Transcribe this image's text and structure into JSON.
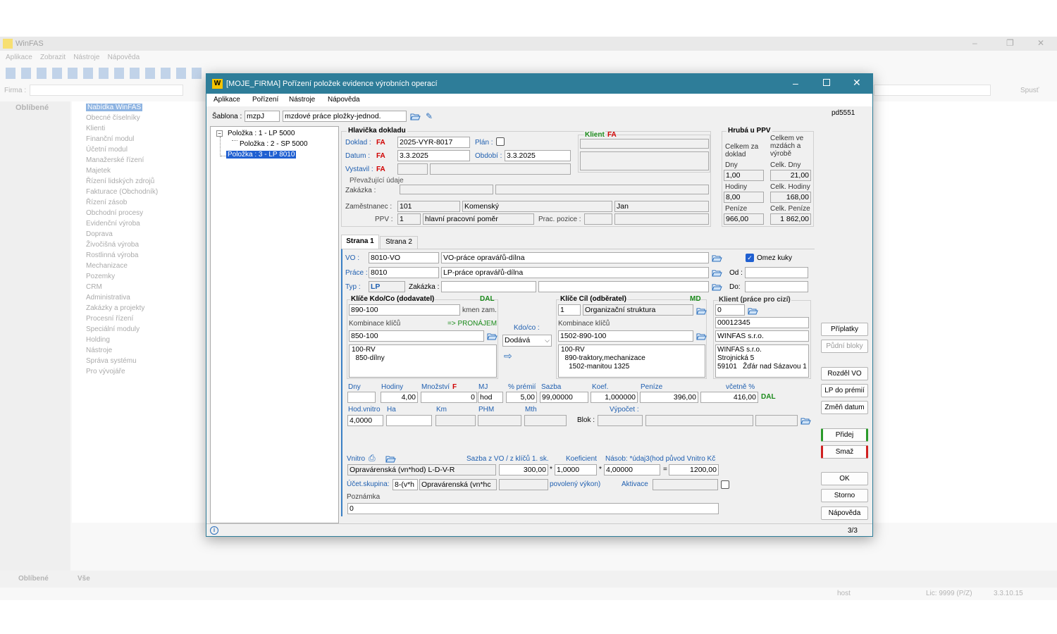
{
  "bg": {
    "title": "WinFAS",
    "menu": [
      "Aplikace",
      "Zobrazit",
      "Nástroje",
      "Nápověda"
    ],
    "firma_label": "Firma :",
    "spust": "Spusť",
    "oblibene": "Oblíbené",
    "tree_root": "Nabídka WinFAS",
    "tree": [
      "Obecné číselníky",
      "Klienti",
      "Finanční modul",
      "Účetní modul",
      "Manažerské řízení",
      "Majetek",
      "Řízení lidských zdrojů",
      "Fakturace (Obchodník)",
      "Řízení zásob",
      "Obchodní procesy",
      "Evidenční výroba",
      "Doprava",
      "Živočišná výroba",
      "Rostlinná výroba",
      "Mechanizace",
      "Pozemky",
      "CRM",
      "Administrativa",
      "Zakázky a projekty",
      "Procesní řízení",
      "Speciální moduly",
      "Holding",
      "Nástroje",
      "Správa systému",
      "Pro vývojáře"
    ],
    "bottom_tabs": [
      "Oblíbené",
      "Vše"
    ],
    "status": [
      "host",
      "Lic: 9999 (P/Z)",
      "3.3.10.15"
    ]
  },
  "dialog": {
    "title": "[MOJE_FIRMA] Pořízení položek evidence výrobních operací",
    "menu": [
      "Aplikace",
      "Pořízení",
      "Nástroje",
      "Nápověda"
    ],
    "code": "pd5551",
    "sablona_label": "Šablona :",
    "sablona_code": "mzpJ",
    "sablona_name": "mzdové práce pložky-jednod.",
    "items": [
      "Položka : 1  - LP  5000",
      "Položka : 2  - SP  5000",
      "Položka : 3  - LP  8010"
    ],
    "hlavicka": {
      "title": "Hlavička dokladu",
      "doklad_label": "Doklad :",
      "doklad_fa": "FA",
      "doklad": "2025-VYR-8017",
      "plan_label": "Plán :",
      "datum_label": "Datum :",
      "datum_fa": "FA",
      "datum": "3.3.2025",
      "obdobi_label": "Období :",
      "obdobi": "3.3.2025",
      "vystavil_label": "Vystavil :",
      "vystavil_fa": "FA",
      "klient_label": "Klient",
      "klient_fa": "FA",
      "prevazujici": "Převažující údaje",
      "zakazka_label": "Zakázka :",
      "zamestnanec_label": "Zaměstnanec :",
      "zam_cislo": "101",
      "zam_prijmeni": "Komenský",
      "zam_jmeno": "Jan",
      "ppv_label": "PPV :",
      "ppv_code": "1",
      "ppv_name": "hlavní pracovní poměr",
      "prac_pozice_label": "Prac. pozice :"
    },
    "hruba": {
      "title": "Hrubá u PPV",
      "celkem_doklad": "Celkem za doklad",
      "celkem_mzdach": "Celkem ve mzdách a výrobě",
      "dny_label": "Dny",
      "dny": "1,00",
      "celk_dny_label": "Celk. Dny",
      "celk_dny": "21,00",
      "hodiny_label": "Hodiny",
      "hodiny": "8,00",
      "celk_hodiny_label": "Celk. Hodiny",
      "celk_hodiny": "168,00",
      "penize_label": "Peníze",
      "penize": "966,00",
      "celk_penize_label": "Celk. Peníze",
      "celk_penize": "1 862,00"
    },
    "tabs": [
      "Strana 1",
      "Strana 2"
    ],
    "vo_label": "VO :",
    "vo_code": "8010-VO",
    "vo_name": "VO-práce opravářů-dílna",
    "omez_kuky": "Omez kuky",
    "prace_label": "Práce :",
    "prace_code": "8010",
    "prace_name": "LP-práce opravářů-dílna",
    "od_label": "Od :",
    "typ_label": "Typ :",
    "typ": "LP",
    "zakazka_label": "Zakázka :",
    "do_label": "Do:",
    "kdo": {
      "title": "Klíče Kdo/Co (dodavatel)",
      "tag": "DAL",
      "code": "890-100",
      "kmen": "kmen zam.",
      "kombinace_label": "Kombinace klíčů",
      "pronajem": "=> PRONÁJEM",
      "kombinace": "850-100",
      "memo": [
        "100-RV",
        "  850-dílny"
      ]
    },
    "kdoco_label": "Kdo/co :",
    "kdoco_value": "Dodává",
    "cil": {
      "title": "Klíče Cíl (odběratel)",
      "tag": "MD",
      "code": "1",
      "name": "Organizační struktura",
      "kombinace_label": "Kombinace klíčů",
      "kombinace": "1502-890-100",
      "memo": [
        "100-RV",
        "  890-traktory,mechanizace",
        "    1502-manitou 1325"
      ]
    },
    "klient_cizi": {
      "title": "Klient (práce pro cizí)",
      "code": "0",
      "ico": "00012345",
      "name": "WINFAS s.r.o.",
      "memo": [
        "WINFAS s.r.o.",
        "Strojnická 5",
        "59101   Žďár nad Sázavou 1"
      ]
    },
    "grid": {
      "dny_label": "Dny",
      "hodiny_label": "Hodiny",
      "mnozstvi_label": "Množství",
      "mnozstvi_f": "F",
      "mj_label": "MJ",
      "premii_label": "% prémií",
      "sazba_label": "Sazba",
      "koef_label": "Koef.",
      "penize_label": "Peníze",
      "vcetne_label": "včetně %",
      "hodiny": "4,00",
      "mnozstvi": "0",
      "mj": "hod",
      "premii": "5,00",
      "sazba": "99,00000",
      "koef": "1,000000",
      "penize": "396,00",
      "vcetne": "416,00",
      "dal": "DAL",
      "hodvnitro_label": "Hod.vnitro",
      "ha_label": "Ha",
      "km_label": "Km",
      "phm_label": "PHM",
      "mth_label": "Mth",
      "vypocet_label": "Výpočet :",
      "blok_label": "Blok :",
      "hodvnitro": "4,0000"
    },
    "vnitro": {
      "label": "Vnitro",
      "sazba_label": "Sazba z VO / z klíčů 1. sk.",
      "koef_label": "Koeficient",
      "nasob_label": "Násob: *údaj3(hod původ Vnitro Kč",
      "name": "Opravárenská (vn*hod) L-D-V-R",
      "sazba": "300,00",
      "koef": "1,0000",
      "nasob": "4,00000",
      "vysledek": "1200,00",
      "ucet_label": "Účet.skupina:",
      "ucet_code": "8-(v*h",
      "ucet_name": "Opravárenská (vn*hc",
      "povoleny": "povolený výkon)",
      "aktivace_label": "Aktivace",
      "poznamka_label": "Poznámka",
      "poznamka": "0"
    },
    "buttons": [
      "Příplatky",
      "Půdní bloky",
      "Rozděl VO",
      "LP do prémií",
      "Změň datum",
      "Přidej",
      "Smaž",
      "OK",
      "Storno",
      "Nápověda"
    ],
    "page": "3/3"
  }
}
